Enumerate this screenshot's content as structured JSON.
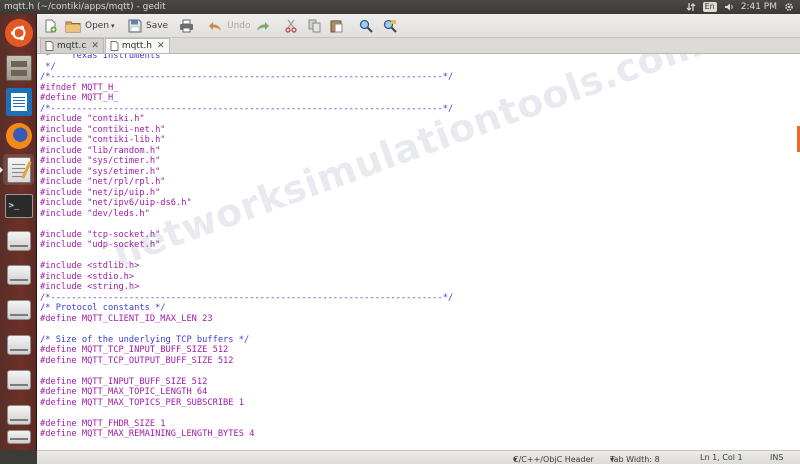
{
  "topbar": {
    "title": "mqtt.h (~/contiki/apps/mqtt) - gedit",
    "lang": "En",
    "time": "2:41 PM"
  },
  "toolbar": {
    "open_label": "Open",
    "save_label": "Save",
    "undo_label": "Undo"
  },
  "tabs": [
    {
      "label": "mqtt.c"
    },
    {
      "label": "mqtt.h"
    }
  ],
  "editor": {
    "lines": [
      {
        "text": " *    Texas Instruments",
        "cls": "c-comment"
      },
      {
        "text": " */",
        "cls": "c-comment"
      },
      {
        "text": "/*---------------------------------------------------------------------------*/",
        "cls": "c-comment"
      },
      {
        "text": "#ifndef MQTT_H_",
        "cls": "c-pre"
      },
      {
        "text": "#define MQTT_H_",
        "cls": "c-pre"
      },
      {
        "text": "/*---------------------------------------------------------------------------*/",
        "cls": "c-comment"
      },
      {
        "text": "#include \"contiki.h\"",
        "cls": "c-pre"
      },
      {
        "text": "#include \"contiki-net.h\"",
        "cls": "c-pre"
      },
      {
        "text": "#include \"contiki-lib.h\"",
        "cls": "c-pre"
      },
      {
        "text": "#include \"lib/random.h\"",
        "cls": "c-pre"
      },
      {
        "text": "#include \"sys/ctimer.h\"",
        "cls": "c-pre"
      },
      {
        "text": "#include \"sys/etimer.h\"",
        "cls": "c-pre"
      },
      {
        "text": "#include \"net/rpl/rpl.h\"",
        "cls": "c-pre"
      },
      {
        "text": "#include \"net/ip/uip.h\"",
        "cls": "c-pre"
      },
      {
        "text": "#include \"net/ipv6/uip-ds6.h\"",
        "cls": "c-pre"
      },
      {
        "text": "#include \"dev/leds.h\"",
        "cls": "c-pre"
      },
      {
        "text": "",
        "cls": "c-plain"
      },
      {
        "text": "#include \"tcp-socket.h\"",
        "cls": "c-pre"
      },
      {
        "text": "#include \"udp-socket.h\"",
        "cls": "c-pre"
      },
      {
        "text": "",
        "cls": "c-plain"
      },
      {
        "text": "#include <stdlib.h>",
        "cls": "c-pre"
      },
      {
        "text": "#include <stdio.h>",
        "cls": "c-pre"
      },
      {
        "text": "#include <string.h>",
        "cls": "c-pre"
      },
      {
        "text": "/*---------------------------------------------------------------------------*/",
        "cls": "c-comment"
      },
      {
        "text": "/* Protocol constants */",
        "cls": "c-comment"
      },
      {
        "text": "#define MQTT_CLIENT_ID_MAX_LEN 23",
        "cls": "c-pre"
      },
      {
        "text": "",
        "cls": "c-plain"
      },
      {
        "text": "/* Size of the underlying TCP buffers */",
        "cls": "c-comment"
      },
      {
        "text": "#define MQTT_TCP_INPUT_BUFF_SIZE 512",
        "cls": "c-pre"
      },
      {
        "text": "#define MQTT_TCP_OUTPUT_BUFF_SIZE 512",
        "cls": "c-pre"
      },
      {
        "text": "",
        "cls": "c-plain"
      },
      {
        "text": "#define MQTT_INPUT_BUFF_SIZE 512",
        "cls": "c-pre"
      },
      {
        "text": "#define MQTT_MAX_TOPIC_LENGTH 64",
        "cls": "c-pre"
      },
      {
        "text": "#define MQTT_MAX_TOPICS_PER_SUBSCRIBE 1",
        "cls": "c-pre"
      },
      {
        "text": "",
        "cls": "c-plain"
      },
      {
        "text": "#define MQTT_FHDR_SIZE 1",
        "cls": "c-pre"
      },
      {
        "text": "#define MQTT_MAX_REMAINING_LENGTH_BYTES 4",
        "cls": "c-pre"
      }
    ]
  },
  "watermark": "networksimulationtools.com",
  "statusbar": {
    "language": "C/C++/ObjC Header",
    "tab_width": "Tab Width: 8",
    "position": "Ln 1, Col 1",
    "mode": "INS"
  }
}
